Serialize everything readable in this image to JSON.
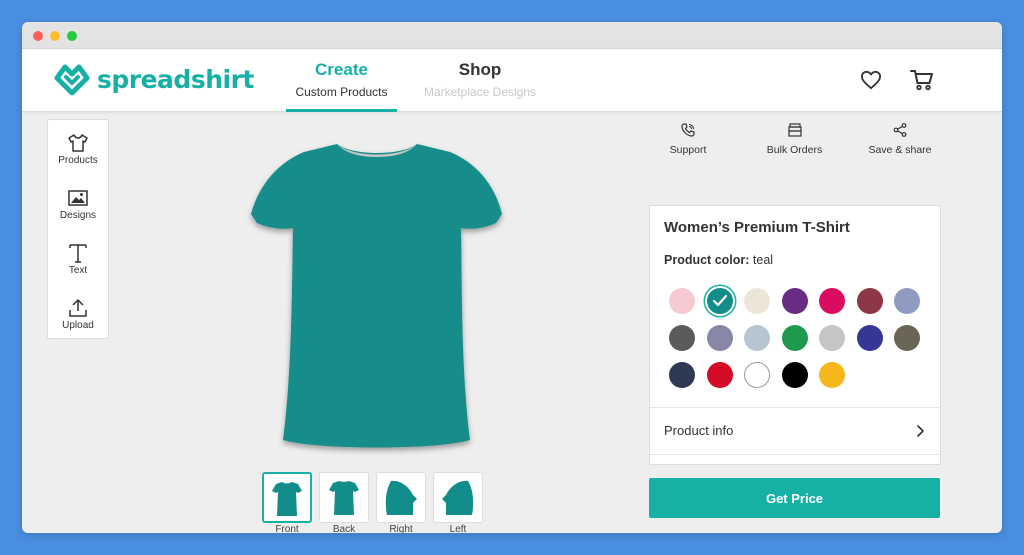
{
  "brand": {
    "name": "spreadshirt",
    "color": "#17b0a5"
  },
  "nav": {
    "create": {
      "label": "Create",
      "sub": "Custom Products"
    },
    "shop": {
      "label": "Shop",
      "sub": "Marketplace Designs"
    }
  },
  "header_icons": [
    "heart-icon",
    "cart-icon"
  ],
  "tools": [
    {
      "label": "Products",
      "icon": "tshirt-icon"
    },
    {
      "label": "Designs",
      "icon": "image-icon"
    },
    {
      "label": "Text",
      "icon": "text-icon"
    },
    {
      "label": "Upload",
      "icon": "upload-icon"
    }
  ],
  "actions": [
    {
      "label": "Support",
      "icon": "phone-icon"
    },
    {
      "label": "Bulk Orders",
      "icon": "stack-icon"
    },
    {
      "label": "Save & share",
      "icon": "share-icon"
    }
  ],
  "product": {
    "title": "Women’s Premium T-Shirt",
    "color_label": "Product color:",
    "color_value": "teal",
    "shirt_color": "#128d8a",
    "colors": [
      {
        "name": "light pink",
        "hex": "#f6c8cf"
      },
      {
        "name": "teal",
        "hex": "#128d8a",
        "selected": true
      },
      {
        "name": "cream heather",
        "hex": "#ece6d9"
      },
      {
        "name": "purple",
        "hex": "#6a2c83"
      },
      {
        "name": "fuchsia",
        "hex": "#dc0b62"
      },
      {
        "name": "burgundy heather",
        "hex": "#8e3746"
      },
      {
        "name": "heather blue",
        "hex": "#8f9bc0"
      },
      {
        "name": "charcoal heather",
        "hex": "#5b5b5d"
      },
      {
        "name": "lavender gray",
        "hex": "#8987a8"
      },
      {
        "name": "ice blue heather",
        "hex": "#b7c5d2"
      },
      {
        "name": "green",
        "hex": "#1e9a4f"
      },
      {
        "name": "heather gray",
        "hex": "#c5c5c7"
      },
      {
        "name": "royal blue",
        "hex": "#343894"
      },
      {
        "name": "olive gray",
        "hex": "#6b6556"
      },
      {
        "name": "navy",
        "hex": "#2e3a53"
      },
      {
        "name": "red",
        "hex": "#d30b26"
      },
      {
        "name": "white",
        "hex": "#ffffff"
      },
      {
        "name": "black",
        "hex": "#000000"
      },
      {
        "name": "yellow",
        "hex": "#f5b71c"
      }
    ],
    "info_label": "Product info"
  },
  "views": [
    {
      "label": "Front",
      "active": true
    },
    {
      "label": "Back"
    },
    {
      "label": "Right"
    },
    {
      "label": "Left"
    }
  ],
  "cta": {
    "label": "Get Price"
  }
}
